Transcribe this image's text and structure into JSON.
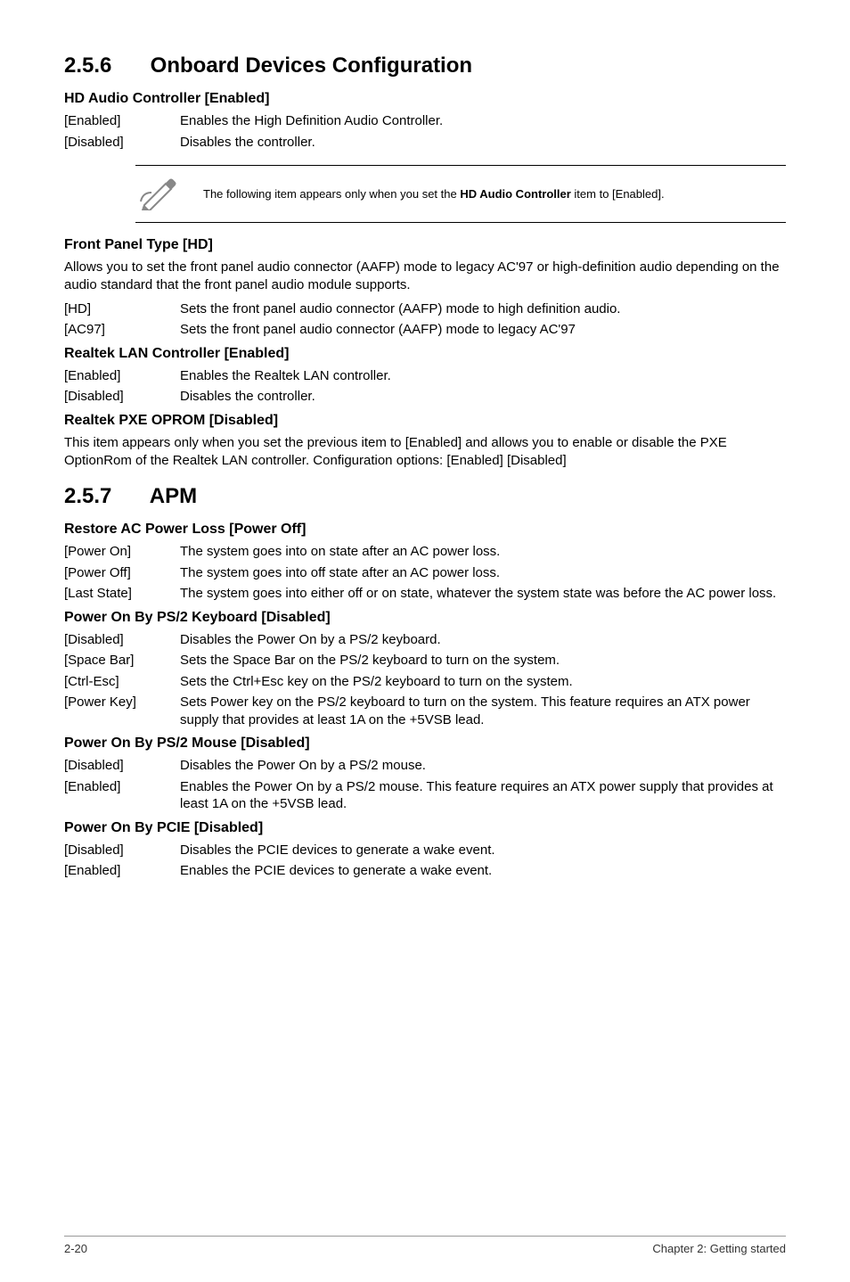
{
  "section256": {
    "number": "2.5.6",
    "title": "Onboard Devices Configuration",
    "hdAudio": {
      "heading": "HD Audio Controller [Enabled]",
      "rows": [
        {
          "label": "[Enabled]",
          "desc": "Enables the High Definition Audio Controller."
        },
        {
          "label": "[Disabled]",
          "desc": "Disables the controller."
        }
      ]
    },
    "note": {
      "textPrefix": "The following item appears only when you set the ",
      "boldText": "HD Audio Controller",
      "textSuffix": " item to [Enabled]."
    },
    "frontPanel": {
      "heading": "Front Panel Type [HD]",
      "intro": "Allows you to set the front panel audio connector (AAFP) mode to legacy AC'97 or high-definition audio depending on the audio standard that the front panel audio module supports.",
      "rows": [
        {
          "label": "[HD]",
          "desc": "Sets the front panel audio connector (AAFP) mode to high definition audio."
        },
        {
          "label": "[AC97]",
          "desc": "Sets the front panel audio connector (AAFP) mode to legacy AC'97"
        }
      ]
    },
    "realtekLan": {
      "heading": "Realtek LAN Controller [Enabled]",
      "rows": [
        {
          "label": "[Enabled]",
          "desc": "Enables the Realtek LAN controller."
        },
        {
          "label": "[Disabled]",
          "desc": "Disables the controller."
        }
      ]
    },
    "realtekPxe": {
      "heading": "Realtek PXE OPROM [Disabled]",
      "body": "This item appears only when you set the previous item to [Enabled] and allows you to enable or disable the PXE OptionRom of the Realtek LAN controller. Configuration options: [Enabled] [Disabled]"
    }
  },
  "section257": {
    "number": "2.5.7",
    "title": "APM",
    "restoreAc": {
      "heading": "Restore AC Power Loss [Power Off]",
      "rows": [
        {
          "label": "[Power On]",
          "desc": "The system goes into on state after an AC power loss."
        },
        {
          "label": "[Power Off]",
          "desc": "The system goes into off state after an AC power loss."
        },
        {
          "label": "[Last State]",
          "desc": "The system goes into either off or on state, whatever the system state was before the AC power loss."
        }
      ]
    },
    "ps2Keyboard": {
      "heading": "Power On By PS/2 Keyboard [Disabled]",
      "rows": [
        {
          "label": "[Disabled]",
          "desc": "Disables the Power On by a PS/2 keyboard."
        },
        {
          "label": "[Space Bar]",
          "desc": "Sets the Space Bar on the PS/2 keyboard to turn on the system."
        },
        {
          "label": "[Ctrl-Esc]",
          "desc": "Sets the Ctrl+Esc key on the PS/2 keyboard to turn on the system."
        },
        {
          "label": "[Power Key]",
          "desc": "Sets Power key on the PS/2 keyboard to turn on the system. This feature requires an ATX power supply that provides at least 1A on the +5VSB lead."
        }
      ]
    },
    "ps2Mouse": {
      "heading": "Power On By PS/2 Mouse [Disabled]",
      "rows": [
        {
          "label": "[Disabled]",
          "desc": "Disables the Power On by a PS/2 mouse."
        },
        {
          "label": "[Enabled]",
          "desc": "Enables the Power On by a PS/2 mouse. This feature requires an ATX power supply that provides at least 1A on the +5VSB lead."
        }
      ]
    },
    "pcie": {
      "heading": "Power On By PCIE [Disabled]",
      "rows": [
        {
          "label": "[Disabled]",
          "desc": "Disables the PCIE devices to generate a wake event."
        },
        {
          "label": "[Enabled]",
          "desc": "Enables the PCIE devices to generate a wake event."
        }
      ]
    }
  },
  "footer": {
    "page": "2-20",
    "chapter": "Chapter 2: Getting started"
  }
}
